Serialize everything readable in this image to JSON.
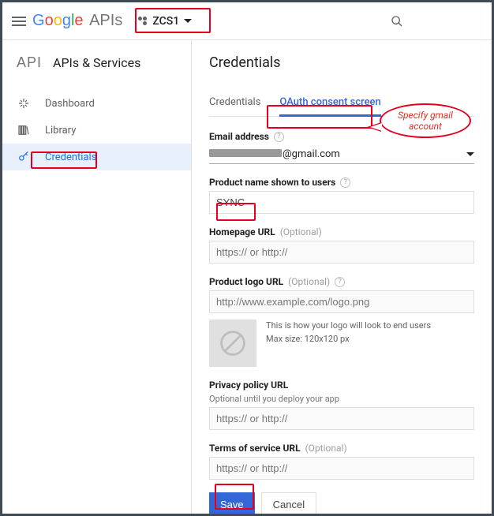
{
  "branding": {
    "suffix": "APIs"
  },
  "header": {
    "project_name": "ZCS1"
  },
  "sidebar": {
    "badge": "API",
    "title": "APIs & Services",
    "items": [
      {
        "label": "Dashboard"
      },
      {
        "label": "Library"
      },
      {
        "label": "Credentials"
      }
    ]
  },
  "main": {
    "title": "Credentials",
    "tabs": [
      {
        "label": "Credentials"
      },
      {
        "label": "OAuth consent screen"
      }
    ],
    "fields": {
      "email": {
        "label": "Email address",
        "value_suffix": "@gmail.com"
      },
      "product_name": {
        "label": "Product name shown to users",
        "value": "SYNC"
      },
      "homepage": {
        "label": "Homepage URL",
        "optional": "(Optional)",
        "placeholder": "https:// or http://"
      },
      "logo_url": {
        "label": "Product logo URL",
        "optional": "(Optional)",
        "placeholder": "http://www.example.com/logo.png",
        "hint1": "This is how your logo will look to end users",
        "hint2": "Max size: 120x120 px"
      },
      "privacy": {
        "label": "Privacy policy URL",
        "subhint": "Optional until you deploy your app",
        "placeholder": "https:// or http://"
      },
      "tos": {
        "label": "Terms of service URL",
        "optional": "(Optional)",
        "placeholder": "https:// or http://"
      }
    },
    "buttons": {
      "save": "Save",
      "cancel": "Cancel"
    }
  },
  "annotations": {
    "callout": "Specify gmail account"
  }
}
